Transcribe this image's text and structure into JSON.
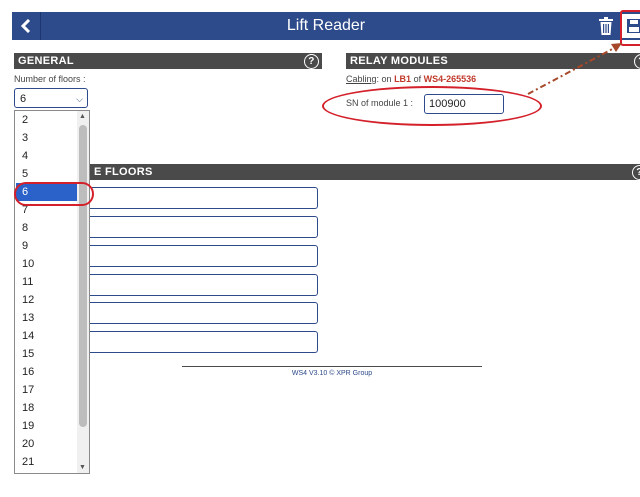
{
  "header": {
    "title": "Lift Reader",
    "back_icon": "chevron-left-icon",
    "delete_icon": "trash-icon",
    "save_icon": "save-icon"
  },
  "general": {
    "section_title": "GENERAL",
    "help": "?",
    "floors_label": "Number of floors :",
    "floors_value": "6",
    "options": [
      "2",
      "3",
      "4",
      "5",
      "6",
      "7",
      "8",
      "9",
      "10",
      "11",
      "12",
      "13",
      "14",
      "15",
      "16",
      "17",
      "18",
      "19",
      "20",
      "21"
    ],
    "selected_option": "6"
  },
  "relay": {
    "section_title": "RELAY MODULES",
    "help": "?",
    "cabling_link": "Cabling",
    "cabling_on": ": on",
    "lb": "LB1",
    "of": "of",
    "device": "WS4-265536",
    "sn_label": "SN of module 1 :",
    "sn_value": "100900"
  },
  "floors": {
    "section_title": "E FLOORS",
    "help": "?"
  },
  "footer": {
    "text": "WS4 V3.10 © XPR Group"
  },
  "colors": {
    "header_bg": "#2d4a8a",
    "section_bg": "#4a4a4a",
    "highlight": "#d4202a",
    "selected": "#2a62c9"
  }
}
